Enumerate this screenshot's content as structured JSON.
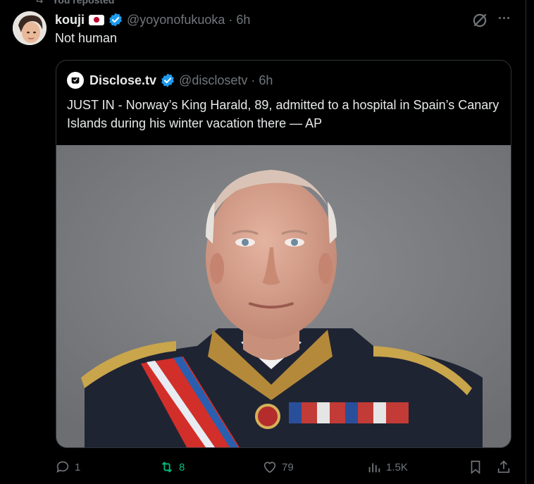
{
  "repost_header": {
    "label": "You reposted"
  },
  "tweet": {
    "author_name": "kouji",
    "handle": "@yoyonofukuoka",
    "time": "· 6h",
    "text": "Not human",
    "more_label": "···"
  },
  "quote": {
    "author_name": "Disclose.tv",
    "handle": "@disclosetv",
    "time": "· 6h",
    "text": "JUST IN - Norway’s King Harald, 89, admitted to a hospital in Spain’s Canary Islands during his winter vacation there — AP"
  },
  "actions": {
    "replies": "1",
    "reposts": "8",
    "likes": "79",
    "views": "1.5K"
  },
  "colors": {
    "background": "#000000",
    "text": "#e7e9ea",
    "muted": "#71767b",
    "verified": "#1d9bf0",
    "repost_active": "#00ba7c",
    "border": "#2f3336"
  },
  "icons": [
    "repost-icon",
    "flag-japan-icon",
    "verified-badge-icon",
    "grok-icon",
    "more-icon",
    "disclose-logo-icon",
    "reply-icon",
    "retweet-icon",
    "like-icon",
    "views-icon",
    "bookmark-icon",
    "share-icon"
  ]
}
